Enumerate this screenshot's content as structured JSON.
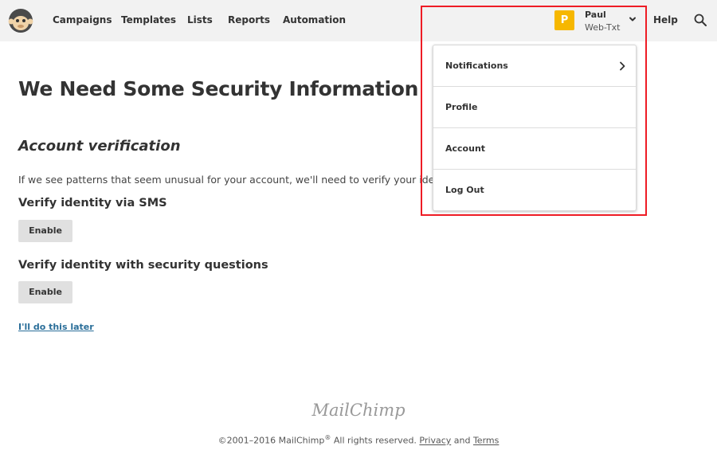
{
  "nav": {
    "logo_icon": "mailchimp-monkey-icon",
    "items": [
      "Campaigns",
      "Templates",
      "Lists",
      "Reports",
      "Automation"
    ],
    "user": {
      "initial": "P",
      "name": "Paul",
      "account": "Web-Txt",
      "avatar_color": "#f6b700"
    },
    "help": "Help",
    "search_icon": "search-icon"
  },
  "main": {
    "title": "We Need Some Security Information",
    "section_title": "Account verification",
    "intro": "If we see patterns that seem unusual for your account, we'll need to verify your identity.",
    "options": [
      {
        "heading": "Verify identity via SMS",
        "button": "Enable"
      },
      {
        "heading": "Verify identity with security questions",
        "button": "Enable"
      }
    ],
    "skip_link": "I'll do this later"
  },
  "dropdown": {
    "items": [
      {
        "label": "Notifications",
        "has_chevron": true
      },
      {
        "label": "Profile",
        "has_chevron": false
      },
      {
        "label": "Account",
        "has_chevron": false
      },
      {
        "label": "Log Out",
        "has_chevron": false
      }
    ],
    "highlight_color": "#ee1c25"
  },
  "footer": {
    "logo": "MailChimp",
    "copyright": "©2001–2016 MailChimp",
    "registered": "®",
    "rights": " All rights reserved. ",
    "privacy": "Privacy",
    "and": " and ",
    "terms": "Terms"
  },
  "colors": {
    "link": "#2a6e99",
    "nav_bg": "#f2f2f2",
    "button_bg": "#e0e0e0"
  }
}
